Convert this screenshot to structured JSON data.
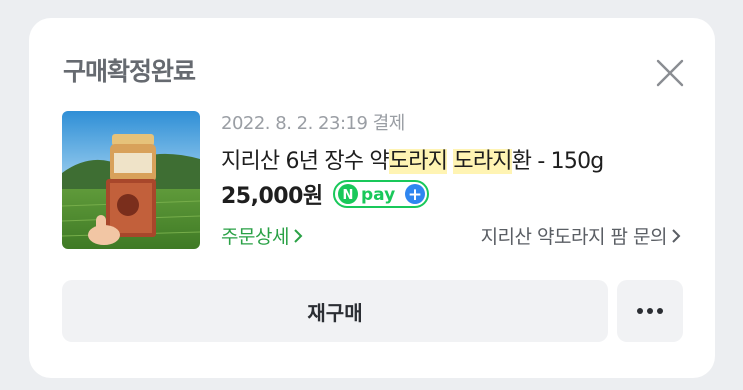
{
  "order": {
    "status": "구매확정완료",
    "date": "2022. 8. 2. 23:19 결제",
    "product": {
      "name_parts": [
        "지리산 6년 장수 약",
        "도라지",
        " ",
        "도라지",
        "환 - 150g"
      ],
      "price": "25,000원",
      "pay_badge": {
        "n": "N",
        "pay": "pay",
        "plus": "+"
      }
    },
    "detail_link": "주문상세",
    "inquiry_link": "지리산 약도라지 팜 문의",
    "rebuy_label": "재구매",
    "icons": {
      "close": "close-icon",
      "more": "more-icon",
      "chevron": "chevron-right-icon"
    },
    "colors": {
      "accent_green": "#2aa146",
      "npay_green": "#19c85a",
      "highlight": "#fff4b3"
    }
  }
}
